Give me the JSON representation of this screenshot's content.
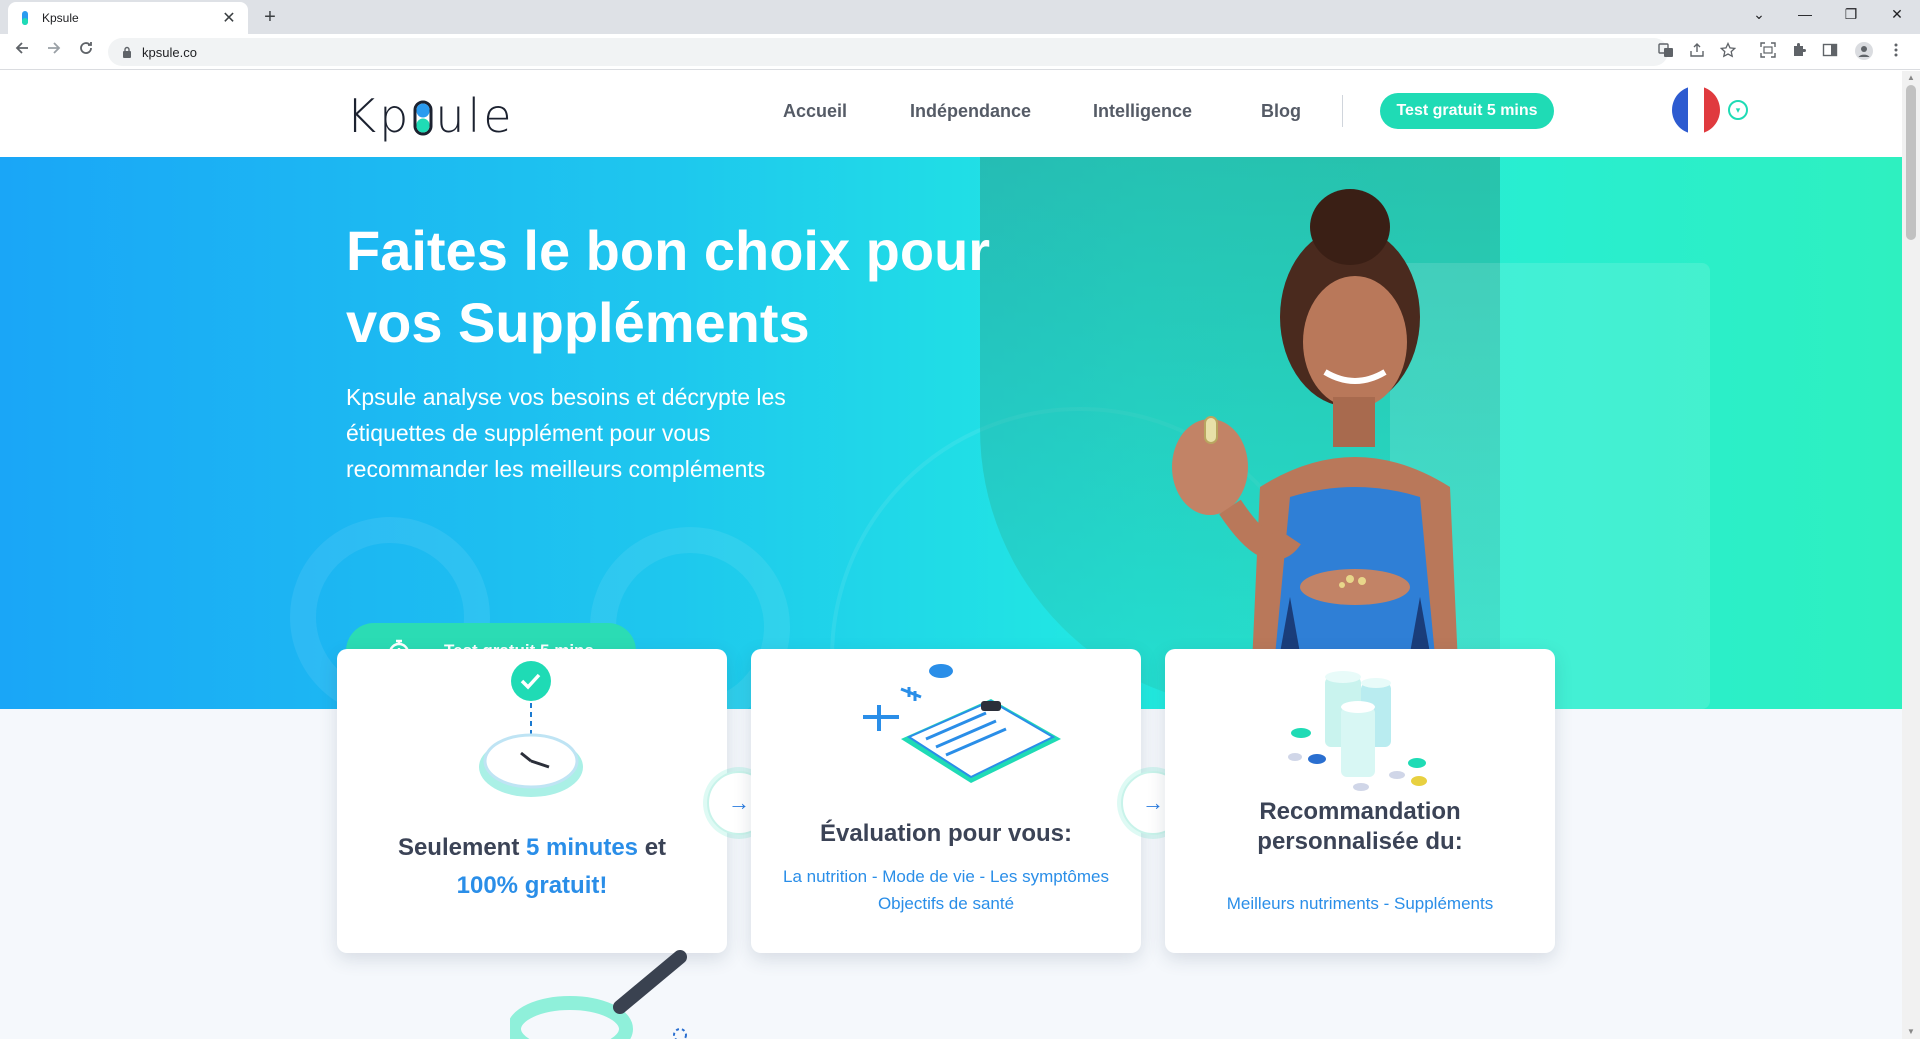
{
  "browser": {
    "tab_title": "Kpsule",
    "tab_close": "✕",
    "new_tab": "+",
    "url": "kpsule.co",
    "window_controls": [
      "⌄",
      "—",
      "❐",
      "✕"
    ]
  },
  "header": {
    "logo_text_a": "Kp",
    "logo_text_b": "ule",
    "nav": [
      "Accueil",
      "Indépendance",
      "Intelligence",
      "Blog"
    ],
    "cta": "Test gratuit 5 mins",
    "lang_chevron": "▾"
  },
  "hero": {
    "title_line1": "Faites le bon choix pour",
    "title_line2": "vos Suppléments",
    "subtitle": "Kpsule analyse vos besoins et décrypte les étiquettes de supplément pour vous recommander les meilleurs compléments",
    "cta": "Test gratuit 5 mins"
  },
  "cards": [
    {
      "heading_pre": "Seulement ",
      "heading_hl": "5 minutes",
      "heading_post": " et",
      "heading_line2": "100% gratuit!"
    },
    {
      "heading": "Évaluation pour vous:",
      "tags_line1": "La nutrition - Mode de vie - Les symptômes",
      "tags_line2": "Objectifs de santé"
    },
    {
      "heading_line1": "Recommandation",
      "heading_line2": "personnalisée du:",
      "tags": "Meilleurs nutriments - Suppléments"
    }
  ],
  "arrows": [
    "→",
    "→"
  ],
  "colors": {
    "brand_teal": "#1fdbb5",
    "brand_blue": "#2a8ee8",
    "text_dark": "#3b4356"
  },
  "icons": [
    "back-arrow-icon",
    "forward-arrow-icon",
    "reload-icon",
    "lock-icon",
    "translate-icon",
    "share-icon",
    "star-icon",
    "screenshot-icon",
    "extensions-icon",
    "sidebar-icon",
    "profile-icon",
    "menu-icon",
    "france-flag-icon",
    "timer-icon",
    "arrow-right-icon"
  ]
}
